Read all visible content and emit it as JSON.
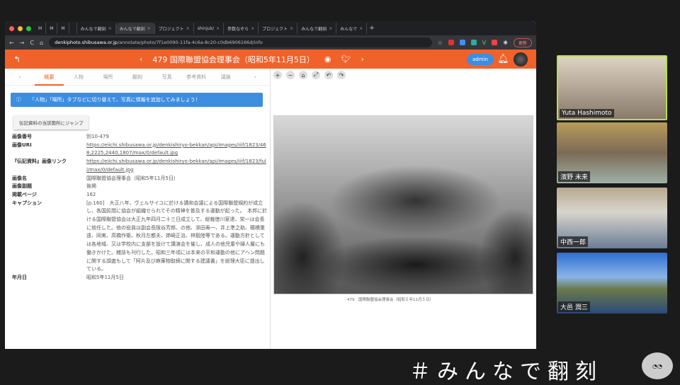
{
  "browser": {
    "tabs": [
      "M",
      "M",
      "M",
      "",
      "みんなで翻刻",
      "みんなで翻刻",
      "プロジェクト",
      "shinjuk/",
      "参数なぞら",
      "プロジェクト",
      "みんなで翻刻",
      "みんなで"
    ],
    "url_host": "denkiphoto.shibusawa.or.jp",
    "url_path": "/annotate/photo/7f1e0090-11fa-4c6a-8c20-c0db6906166d/info",
    "update_label": "更新"
  },
  "header": {
    "title": "479 国際聯盟協会理事会（昭和5年11月5日）",
    "admin_label": "admin"
  },
  "tabs": [
    "概要",
    "人物",
    "場所",
    "翻刻",
    "写真",
    "参考資料",
    "議論"
  ],
  "alert": "「人物」「場所」タブなどに切り替えて、写真に情報を追加してみましょう！",
  "jump_button": "伝記資料の当該箇所にジャンプ",
  "fields": [
    {
      "k": "画像番号",
      "v": "別10-479"
    },
    {
      "k": "画像URI",
      "v": "https://eiichi.shibusawa.or.jp/denkishiryo-bekkan/api/images/iiif/1823/468,2225,2440,1807/max/0/default.jpg",
      "link": true
    },
    {
      "k": "『伝記資料』画像リンク",
      "v": "https://eiichi.shibusawa.or.jp/denkishiryo-bekkan/api/images/iiif/1823/full/max/0/default.jpg",
      "link": true
    },
    {
      "k": "画像名",
      "v": "国際聯盟協会理事会（昭和5年11月5日）"
    },
    {
      "k": "画像副題",
      "v": "後掲"
    },
    {
      "k": "掲載ページ",
      "v": "162"
    },
    {
      "k": "キャプション",
      "v": "[p.160]　大正八年、ヴェルサイユに於ける講和会議による国際聯盟規約が成立し、各国民間に協会が組織せられてその精神を普及する運動が起った。　本邦に於ける国際聯盟協会は大正九年四月二十三日成立して、総裁徳川家達、栄一は会長に就任した。他の役員は副会長阪谷芳郎、の他、添田寿一、井上準之助、穂積重遠、同実、高橋作衛、秋月左都夫、姉崎正治、林毅陸等である。運動方針としては各地域、又は学校内に支部を設けて講演会を催し、成人の他児童や婦人層にも働きかけた。雑誌も刊行した。昭和三年頃には本来の平和運動の他にアヘン問題に関する調査もして「阿片及び麻薬物取締に関する建議書」を総理大臣に提出している。"
    },
    {
      "k": "年月日",
      "v": "昭和5年11月5日"
    }
  ],
  "photo_caption": "479　国際聯盟協会理事会（昭和５年11月５日）",
  "participants": [
    "Yuta Hashimoto",
    "濱野 未来",
    "中西一郎",
    "大邑 潤三"
  ],
  "overlay": "＃みんなで翻刻",
  "colors": {
    "accent": "#f0622a",
    "info": "#3d8de0"
  }
}
